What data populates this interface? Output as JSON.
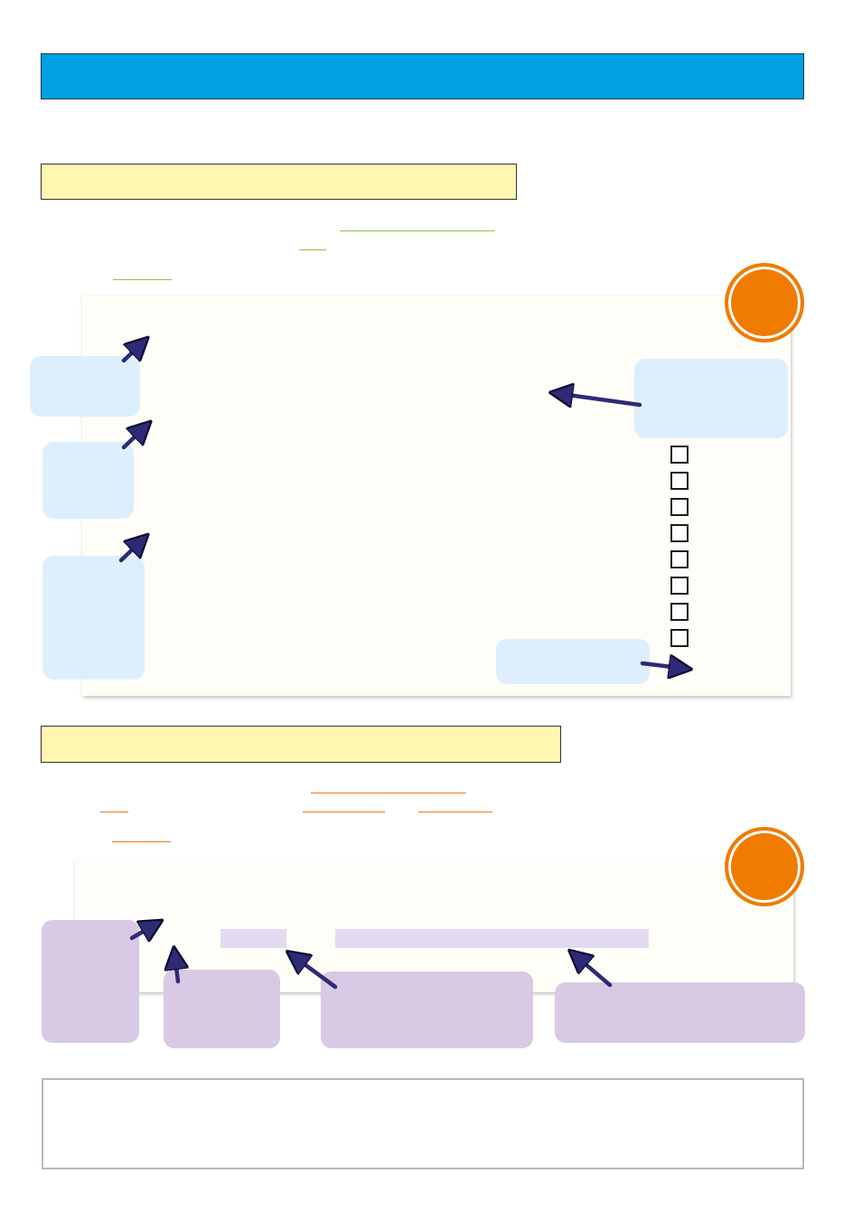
{
  "header": {
    "title": ""
  },
  "section1": {
    "heading": "",
    "panel": {
      "callouts": [
        "",
        "",
        "",
        "",
        ""
      ],
      "checkbox_count": 8
    }
  },
  "section2": {
    "heading": "",
    "panel": {
      "callouts": [
        "",
        "",
        "",
        ""
      ]
    }
  },
  "footer": {
    "text": ""
  },
  "colors": {
    "title_bar": "#00a0e3",
    "heading_bar": "#fff7b0",
    "panel": "#fffdf7",
    "callout_blue": "#ddeffc",
    "callout_purple": "#d8c9e4",
    "badge": "#ef7b00",
    "link_green": "#8cc63f",
    "link_orange": "#ef7b1a",
    "arrow": "#2e2a78"
  }
}
